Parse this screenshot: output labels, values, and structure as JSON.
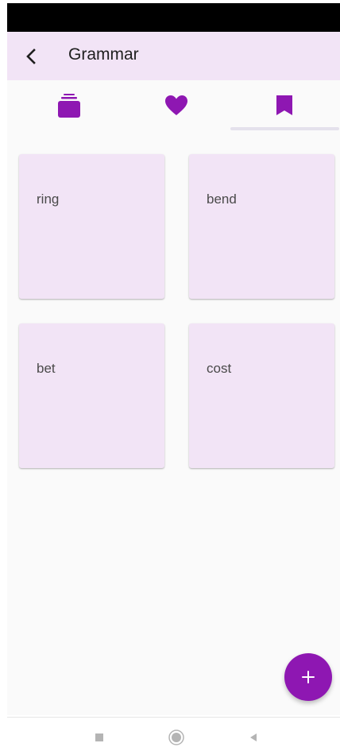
{
  "app_bar": {
    "title": "Grammar",
    "background": "#f2e4f6",
    "back_icon": "chevron-left-icon"
  },
  "tabs": [
    {
      "icon": "card-stack-icon",
      "selected": false
    },
    {
      "icon": "heart-icon",
      "selected": false
    },
    {
      "icon": "bookmark-icon",
      "selected": true
    }
  ],
  "accent_color": "#8e17b2",
  "cards": [
    {
      "text": "ring"
    },
    {
      "text": "bend"
    },
    {
      "text": "bet"
    },
    {
      "text": "cost"
    }
  ],
  "fab": {
    "icon": "plus-icon"
  },
  "system_nav": [
    {
      "icon": "recents-square-icon"
    },
    {
      "icon": "home-circle-icon"
    },
    {
      "icon": "back-triangle-icon"
    }
  ]
}
